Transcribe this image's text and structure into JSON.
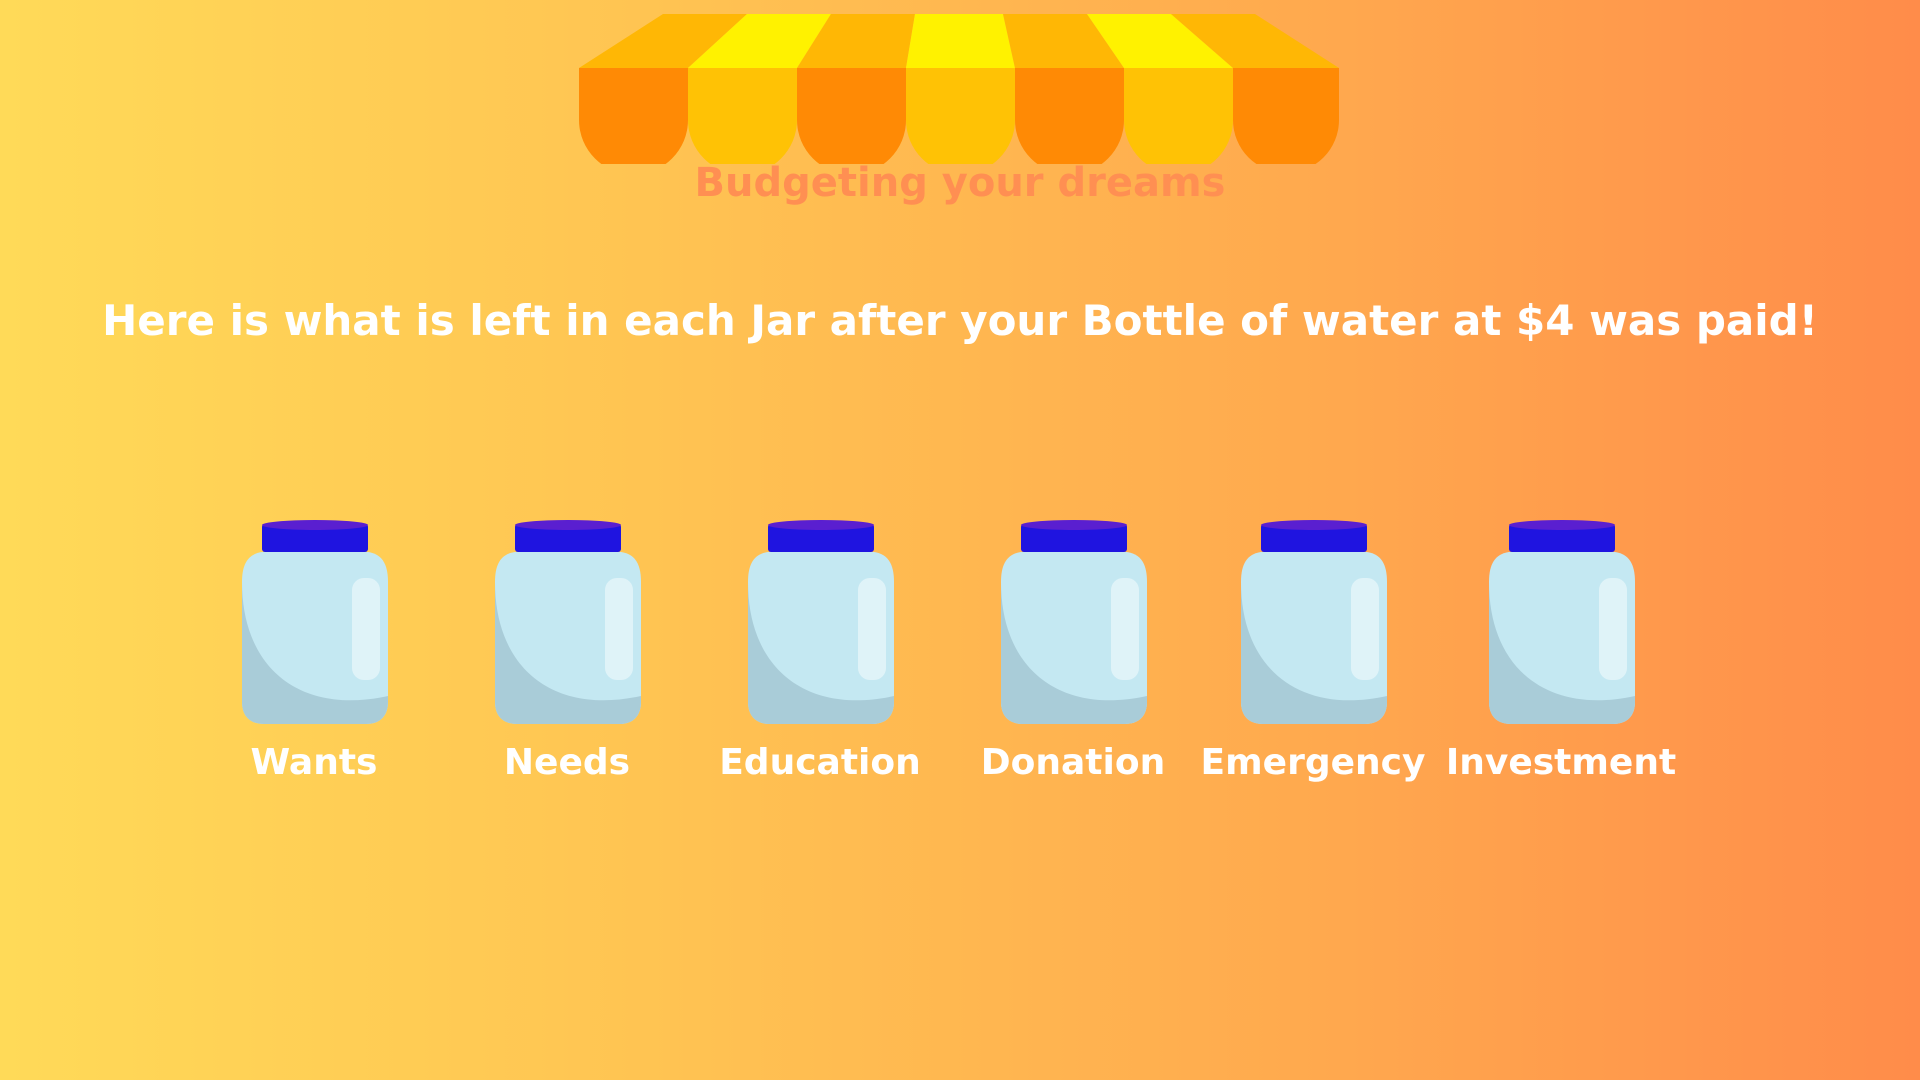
{
  "brand": {
    "title": "Budgeting your dreams",
    "color": "#FF8F52"
  },
  "headline": "Here is what is left in each Jar after your Bottle of water at $4 was paid!",
  "colors": {
    "background_left": "#FFDA58",
    "background_right": "#FF8C4A",
    "awning_orange": "#FF8A05",
    "awning_gold": "#FFC205",
    "awning_yellow": "#FFF200",
    "jar_glass": "#C4E8F2",
    "jar_shade": "#A9CCD8",
    "jar_lid": "#1F14E0"
  },
  "jars": [
    {
      "label": "Wants",
      "icon": "jar-icon"
    },
    {
      "label": "Needs",
      "icon": "jar-icon"
    },
    {
      "label": "Education",
      "icon": "jar-icon"
    },
    {
      "label": "Donation",
      "icon": "jar-icon"
    },
    {
      "label": "Emergency",
      "icon": "jar-icon"
    },
    {
      "label": "Investment",
      "icon": "jar-icon"
    }
  ]
}
